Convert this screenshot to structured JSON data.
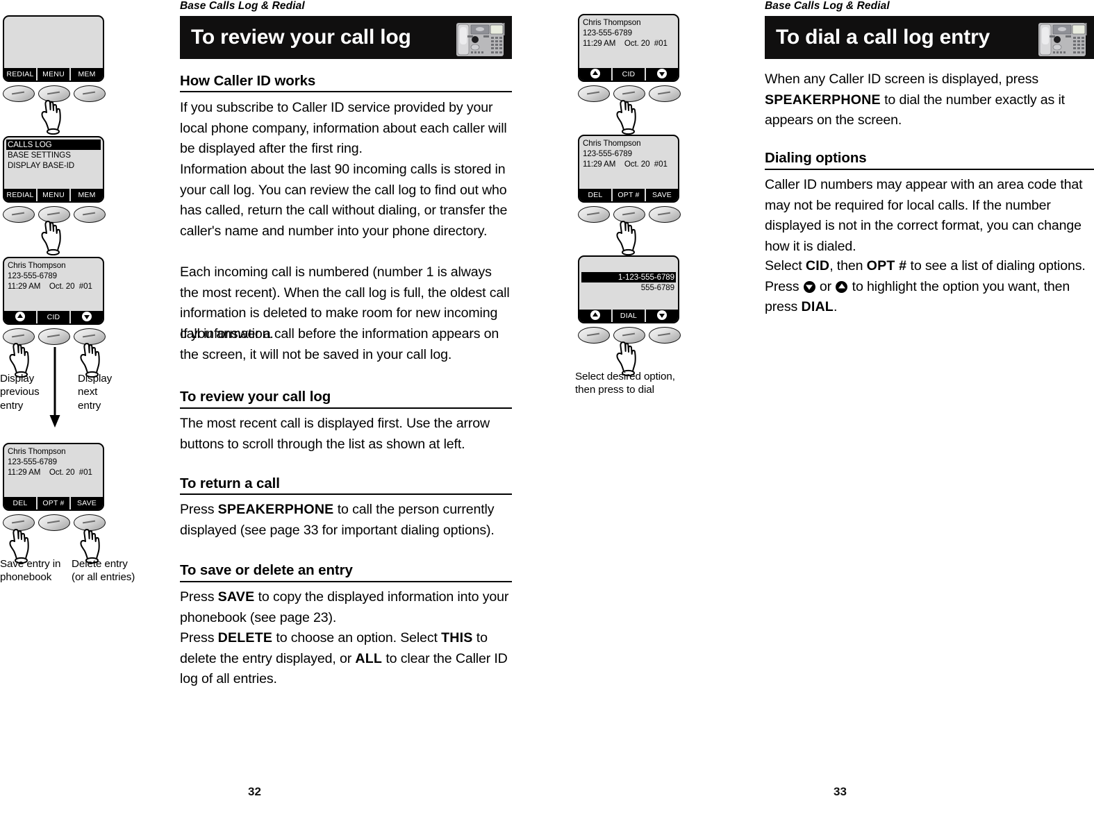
{
  "pages": {
    "left": {
      "running_head": "Base Calls Log & Redial",
      "banner_title": "To review your call log",
      "page_number": "32",
      "sections": [
        {
          "heading": "How Caller ID works",
          "paragraphs": [
            "If you subscribe to Caller ID service provided by your local phone company, information about each caller will be displayed after the first ring.",
            "Information about the last 90 incoming calls is stored in your call log. You can review the call log to find out who has called, return the call without dialing, or transfer the caller's name and number into your phone directory.",
            "Each incoming call is numbered (number 1 is always the most recent). When the call log is full, the oldest call information is deleted to make room for new incoming call information.",
            "If you answer a call before the information appears on the screen, it will not be saved in your call log."
          ]
        },
        {
          "heading": "To review your call log",
          "paragraphs": [
            "The most recent call is displayed first. Use the arrow buttons to scroll through the list as shown at left."
          ]
        },
        {
          "heading": "To return a call",
          "paragraphs": []
        },
        {
          "heading": "To save or delete an entry",
          "paragraphs": []
        }
      ]
    },
    "right": {
      "running_head": "Base Calls Log & Redial",
      "banner_title": "To dial a call log entry",
      "page_number": "33",
      "intro_prefix": "When any Caller ID screen is displayed, press ",
      "intro_bold": "SPEAKERPHONE",
      "intro_suffix": " to dial the number exactly as it appears on the screen.",
      "dialing_heading": "Dialing options",
      "dialing_para": "Caller ID numbers may appear with an area code that may not be required for local calls. If the number displayed is not in the correct format, you can change how it is dialed.",
      "select_p1": "Select ",
      "select_b1": "CID",
      "select_p2": ", then ",
      "select_b2": "OPT #",
      "select_p3": " to see a list of dialing options. Press ",
      "select_p4": " or ",
      "select_p5": " to highlight the option you want, then press ",
      "select_b3": "DIAL",
      "select_p6": "."
    }
  },
  "return_call": {
    "p1": "Press ",
    "b1": "SPEAKERPHONE",
    "p2": " to call the person currently displayed (see page 33 for important dialing options)."
  },
  "save_delete": {
    "s1_p1": "Press ",
    "s1_b1": "SAVE",
    "s1_p2": " to copy the displayed information into your phonebook (see page 23).",
    "s2_p1": "Press ",
    "s2_b1": "DELETE",
    "s2_p2": " to choose an option. Select ",
    "s2_b2": "THIS",
    "s2_p3": " to delete the entry displayed, or ",
    "s2_b3": "ALL",
    "s2_p4": " to clear the Caller ID log of all entries."
  },
  "screens": {
    "idle": {
      "lines": [],
      "softkeys": [
        "REDIAL",
        "MENU",
        "MEM"
      ]
    },
    "menu": {
      "lines": [
        "CALLS LOG",
        "BASE SETTINGS",
        "DISPLAY BASE-ID"
      ],
      "highlight_index": 0,
      "softkeys": [
        "REDIAL",
        "MENU",
        "MEM"
      ]
    },
    "cid_entry": {
      "name": "Chris Thompson",
      "number": "123-555-6789",
      "time": "11:29 AM",
      "date": "Oct. 20",
      "index": "#01",
      "softkeys": [
        "up-arrow",
        "CID",
        "down-arrow"
      ]
    },
    "cid_entry_opt": {
      "name": "Chris Thompson",
      "number": "123-555-6789",
      "time": "11:29 AM",
      "date": "Oct. 20",
      "index": "#01",
      "softkeys": [
        "DEL",
        "OPT #",
        "SAVE"
      ]
    },
    "dial_options": {
      "option_highlighted": "1-123-555-6789",
      "option_second": "555-6789",
      "softkeys": [
        "up-arrow",
        "DIAL",
        "down-arrow"
      ]
    }
  },
  "captions": {
    "display_previous": "Display\nprevious\nentry",
    "display_previous_l1": "Display",
    "display_previous_l2": "previous",
    "display_previous_l3": "entry",
    "display_next_l1": "Display",
    "display_next_l2": "next",
    "display_next_l3": "entry",
    "save_entry_l1": "Save entry in",
    "save_entry_l2": "phonebook",
    "delete_entry_l1": "Delete entry",
    "delete_entry_l2": "(or all entries)",
    "select_option_l1": "Select desired option,",
    "select_option_l2": "then press to dial"
  },
  "colors": {
    "banner_bg": "#100f0f",
    "lcd_bg": "#dcdcdc",
    "softkey_bg": "#000000",
    "text": "#000000"
  }
}
